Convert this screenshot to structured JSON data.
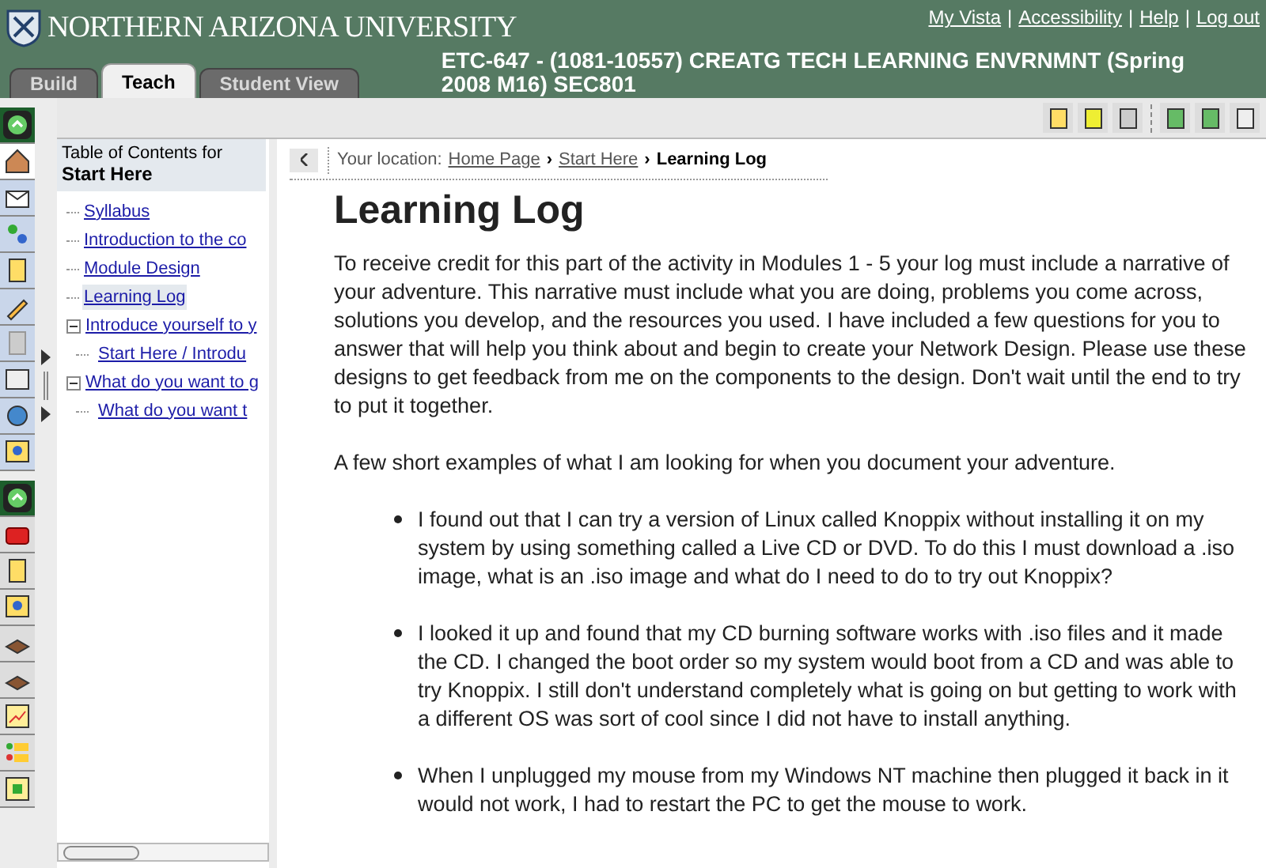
{
  "header": {
    "university": "NORTHERN ARIZONA UNIVERSITY",
    "links": [
      "My Vista",
      "Accessibility",
      "Help",
      "Log out"
    ],
    "separator": "|"
  },
  "tabs": [
    {
      "label": "Build",
      "selected": false
    },
    {
      "label": "Teach",
      "selected": true
    },
    {
      "label": "Student View",
      "selected": false
    }
  ],
  "course_title": [
    "ETC-647 - (1081-10557) CREATG TECH LEARNING ENVRNMNT (Spring",
    "2008 M16) SEC801"
  ],
  "toc": {
    "heading": "Table of Contents for",
    "heading_bold": "Start Here",
    "items": [
      {
        "label": "Syllabus",
        "selected": false,
        "expanded": false
      },
      {
        "label": "Introduction to the co",
        "selected": false,
        "expanded": false
      },
      {
        "label": "Module Design",
        "selected": false,
        "expanded": false
      },
      {
        "label": "Learning Log",
        "selected": true,
        "expanded": false
      },
      {
        "label": "Introduce yourself to y",
        "selected": false,
        "expanded": true,
        "children": [
          {
            "label": "Start Here / Introdu",
            "selected": false
          }
        ]
      },
      {
        "label": "What do you want to g",
        "selected": false,
        "expanded": true,
        "children": [
          {
            "label": "What do you want t",
            "selected": false
          }
        ]
      }
    ]
  },
  "breadcrumb": {
    "prefix": "Your location:",
    "links": [
      "Home Page",
      "Start Here"
    ],
    "current": "Learning Log",
    "separator": "›"
  },
  "page_title": "Learning Log",
  "paragraphs": [
    "To receive credit for this part of the activity in Modules 1 - 5 your log must include a narrative of your adventure.  This narrative must include what you are doing, problems you come across, solutions you develop, and the resources you used.  I have included a few questions for you to answer that will help you think about and begin to create your Network Design. Please use these designs to get feedback from me on the components to the design. Don't wait until the end to try to put it together.",
    "A few short examples of what I am looking for when you document your adventure."
  ],
  "bullets": [
    "I found out that I can try a version of Linux called Knoppix without installing it on my system by using something called a Live CD or DVD.  To do this I must download a .iso image, what is an .iso image and what do I need to do to try out Knoppix?",
    "I looked it up and found that my CD burning software works with .iso files and it made the CD.  I changed the boot order so my system would boot from a CD and was able to try Knoppix.  I still don't understand completely what is going on but getting to work with a different OS was sort of cool since I did not have to install anything.",
    "When I unplugged my mouse from my Windows NT machine then plugged it back in it would not work, I had to restart the PC to get the mouse to work."
  ]
}
